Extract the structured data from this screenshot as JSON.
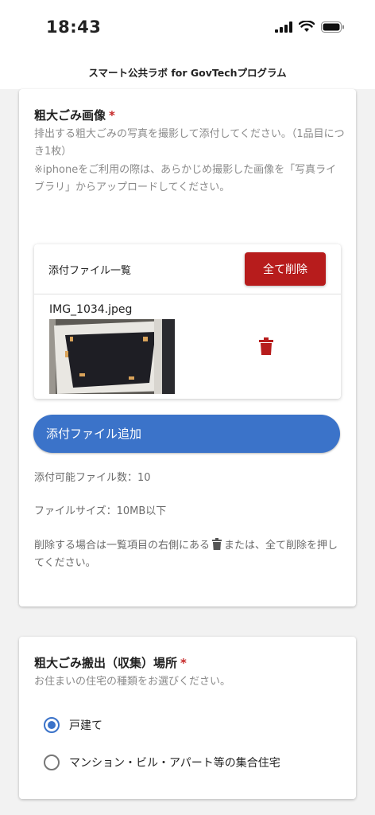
{
  "status_bar": {
    "time": "18:43"
  },
  "header": {
    "title": "スマート公共ラボ for GovTechプログラム"
  },
  "image_section": {
    "title": "粗大ごみ画像",
    "required_mark": "*",
    "description": "排出する粗大ごみの写真を撮影して添付してください。（1品目につき1枚）",
    "iphone_note": "※iphoneをご利用の際は、あらかじめ撮影した画像を「写真ライブラリ」からアップロードしてください。",
    "file_list": {
      "label": "添付ファイル一覧",
      "delete_all_label": "全て削除",
      "files": [
        {
          "name": "IMG_1034.jpeg"
        }
      ]
    },
    "add_button_label": "添付ファイル追加",
    "max_files_note": "添付可能ファイル数：10",
    "max_size_note": "ファイルサイズ：10MB以下",
    "delete_note_before": "削除する場合は一覧項目の右側にある",
    "delete_note_after": "または、全て削除を押してください。"
  },
  "location_section": {
    "title": "粗大ごみ搬出（収集）場所",
    "required_mark": "*",
    "description": "お住まいの住宅の種類をお選びください。",
    "options": [
      {
        "label": "戸建て",
        "selected": true
      },
      {
        "label": "マンション・ビル・アパート等の集合住宅",
        "selected": false
      }
    ]
  },
  "colors": {
    "accent": "#3b73c9",
    "danger": "#b71c1c"
  }
}
